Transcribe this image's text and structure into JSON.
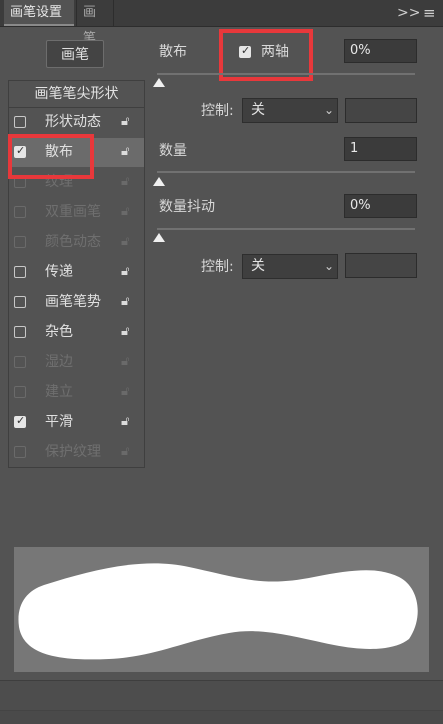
{
  "tabs": [
    {
      "label": "画笔设置"
    },
    {
      "label": "画笔"
    }
  ],
  "toolbar_icons": [
    "expand-icon",
    "menu-icon"
  ],
  "brush_button": {
    "label": "画笔"
  },
  "list": {
    "title": "画笔笔尖形状",
    "items": [
      {
        "label": "形状动态",
        "checked": false,
        "enabled": true,
        "selected": false
      },
      {
        "label": "散布",
        "checked": true,
        "enabled": true,
        "selected": true
      },
      {
        "label": "纹理",
        "checked": false,
        "enabled": false,
        "selected": false
      },
      {
        "label": "双重画笔",
        "checked": false,
        "enabled": false,
        "selected": false
      },
      {
        "label": "颜色动态",
        "checked": false,
        "enabled": false,
        "selected": false
      },
      {
        "label": "传递",
        "checked": false,
        "enabled": true,
        "selected": false
      },
      {
        "label": "画笔笔势",
        "checked": false,
        "enabled": true,
        "selected": false
      },
      {
        "label": "杂色",
        "checked": false,
        "enabled": true,
        "selected": false
      },
      {
        "label": "湿边",
        "checked": false,
        "enabled": false,
        "selected": false
      },
      {
        "label": "建立",
        "checked": false,
        "enabled": false,
        "selected": false
      },
      {
        "label": "平滑",
        "checked": true,
        "enabled": true,
        "selected": false
      },
      {
        "label": "保护纹理",
        "checked": false,
        "enabled": false,
        "selected": false
      }
    ]
  },
  "scatter": {
    "label": "散布",
    "both_axes_label": "两轴",
    "both_axes_checked": true,
    "value": "0%",
    "slider_fraction": 0,
    "control_label": "控制:",
    "control_value": "关"
  },
  "count": {
    "label": "数量",
    "value": "1",
    "slider_fraction": 0
  },
  "count_jitter": {
    "label": "数量抖动",
    "value": "0%",
    "slider_fraction": 0,
    "control_label": "控制:",
    "control_value": "关"
  },
  "colors": {
    "highlight": "#e8383b",
    "panel": "#535353",
    "preview_bg": "#777777",
    "stroke": "#ffffff"
  }
}
